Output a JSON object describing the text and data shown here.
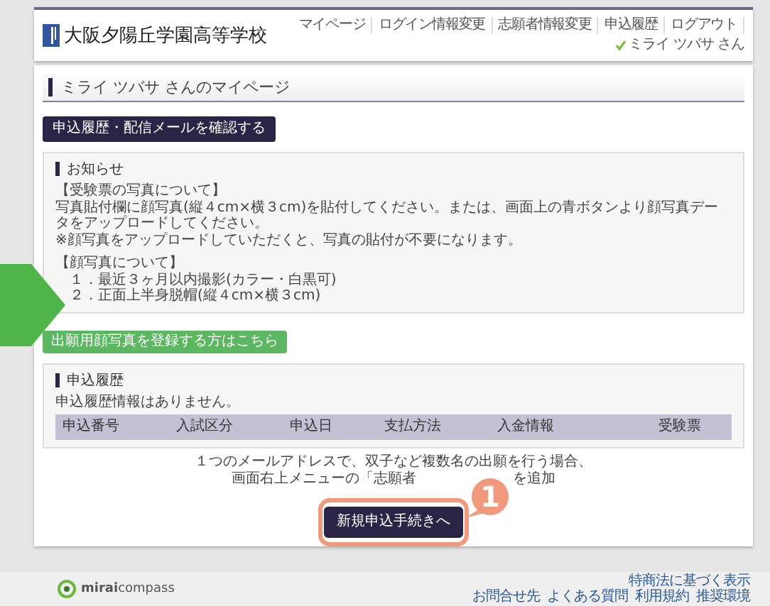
{
  "header": {
    "school_name": "大阪夕陽丘学園高等学校",
    "nav": [
      "マイページ",
      "ログイン情報変更",
      "志願者情報変更",
      "申込履歴",
      "ログアウト"
    ],
    "user": "ミライ ツバサ さん"
  },
  "page_title": "ミライ ツバサ さんのマイページ",
  "history_mail_button": "申込履歴・配信メールを確認する",
  "notice": {
    "heading": "お知らせ",
    "sections": [
      {
        "title": "【受験票の写真について】",
        "lines": [
          "写真貼付欄に顔写真(縦４cm×横３cm)を貼付してください。または、画面上の青ボタンより顔写真データをアップロードしてください。",
          "※顔写真をアップロードしていただくと、写真の貼付が不要になります。"
        ]
      },
      {
        "title": "【顔写真について】",
        "items": [
          "１．最近３ヶ月以内撮影(カラー・白黒可)",
          "２．正面上半身脱帽(縦４cm×横３cm)"
        ]
      }
    ]
  },
  "photo_button": "出願用顔写真を登録する方はこちら",
  "history": {
    "heading": "申込履歴",
    "empty_message": "申込履歴情報はありません。",
    "columns": [
      "申込番号",
      "入試区分",
      "申込日",
      "支払方法",
      "入金情報",
      "受験票"
    ]
  },
  "guidance": {
    "line_1": "１つのメールアドレスで、双子など複数名の出願を行う場合、",
    "line_2_start": "画面右上メニューの「志願者",
    "line_2_end": "を追加"
  },
  "new_application_button": "新規申込手続きへ",
  "callout": {
    "number": "1"
  },
  "footer": {
    "brand": "**mirai**compass",
    "links_top": [
      "特商法に基づく表示"
    ],
    "links": [
      "お問合せ先",
      "よくある質問",
      "利用規約",
      "推奨環境"
    ]
  }
}
